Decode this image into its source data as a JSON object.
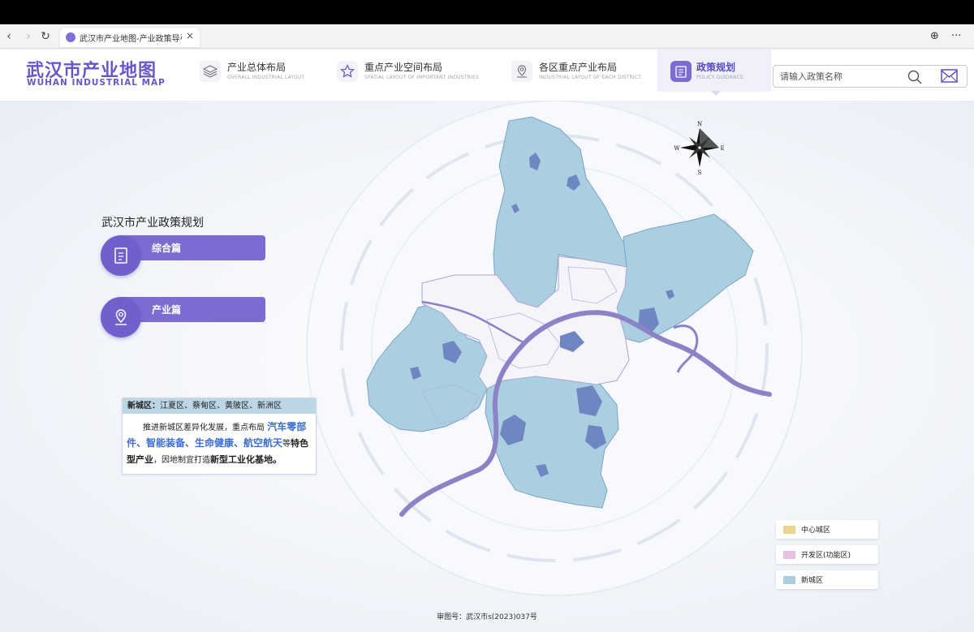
{
  "browser": {
    "tab_title": "武汉市产业地图-产业政策导引",
    "close_glyph": "×",
    "back_glyph": "‹",
    "forward_glyph": "›",
    "reload_glyph": "↻",
    "globe_glyph": "⊕",
    "more_glyph": "···"
  },
  "header": {
    "logo_cn": "武汉市产业地图",
    "logo_en": "WUHAN INDUSTRIAL MAP",
    "nav": [
      {
        "cn": "产业总体布局",
        "en": "OVERALL INDUSTRIAL LAYOUT",
        "icon": "layers-icon"
      },
      {
        "cn": "重点产业空间布局",
        "en": "SPATIAL LAYOUT OF IMPORTANT INDUSTRIES",
        "icon": "star-icon"
      },
      {
        "cn": "各区重点产业布局",
        "en": "INDUSTRIAL LAYOUT OF EACH DISTRICT",
        "icon": "map-pin-icon"
      },
      {
        "cn": "政策规划",
        "en": "POLICY GUIDANCE",
        "icon": "book-icon",
        "active": true
      }
    ],
    "search_placeholder": "请输入政策名称"
  },
  "panel": {
    "title": "武汉市产业政策规划",
    "buttons": [
      {
        "label": "综合篇",
        "icon": "document-icon"
      },
      {
        "label": "产业篇",
        "icon": "location-icon"
      }
    ]
  },
  "info_card": {
    "head_label": "新城区：",
    "head_districts": "江夏区、蔡甸区、黄陂区、新洲区",
    "body_1": "推进新城区差异化发展，重点布局",
    "highlight_1": "汽车零部件、智能装备、生命健康、航空航天",
    "body_2": "等",
    "bold_1": "特色型产业",
    "body_3": "，因地制宜打造",
    "bold_2": "新型工业化基地。"
  },
  "compass": {
    "n": "N",
    "s": "S",
    "e": "E",
    "w": "W"
  },
  "legend": [
    {
      "label": "中心城区",
      "color": "#ecd48e"
    },
    {
      "label": "开发区(功能区)",
      "color": "#e8bfe0"
    },
    {
      "label": "新城区",
      "color": "#a9cfe0"
    }
  ],
  "approval": "审图号：武汉市s(2023)037号",
  "colors": {
    "accent": "#6757c9",
    "new_district": "#a9cfe0",
    "river": "#8c83c6"
  }
}
